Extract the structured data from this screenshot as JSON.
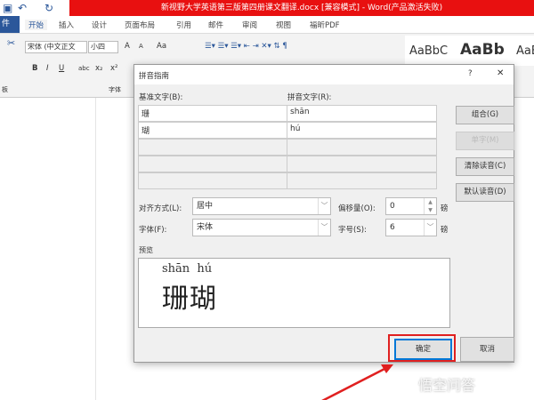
{
  "window": {
    "title": "新视野大学英语第三版第四册课文翻译.docx [兼容模式] - Word(产品激活失败)"
  },
  "qat": {
    "save_icon": "save-icon",
    "undo_icon": "undo-icon",
    "redo_icon": "redo-icon"
  },
  "tabs": {
    "file": "件",
    "items": [
      "开始",
      "插入",
      "设计",
      "页面布局",
      "引用",
      "邮件",
      "审阅",
      "视图",
      "福昕PDF"
    ]
  },
  "ribbon": {
    "font_name": "宋体 (中文正文",
    "font_size": "小四",
    "grow": "A",
    "shrink": "A",
    "case": "Aa",
    "bold": "B",
    "italic": "I",
    "underline": "U",
    "strike": "abc",
    "sub": "x₂",
    "sup": "x²",
    "font_group": "字体",
    "clipboard_group": "板",
    "styles": [
      "AaBbC",
      "AaBb",
      "AaE"
    ]
  },
  "dialog": {
    "title": "拼音指南",
    "help": "?",
    "close": "✕",
    "base_label": "基准文字(B):",
    "ruby_label": "拼音文字(R):",
    "rows": [
      {
        "base": "珊",
        "ruby": "shān"
      },
      {
        "base": "瑚",
        "ruby": "hú"
      },
      {
        "base": "",
        "ruby": ""
      },
      {
        "base": "",
        "ruby": ""
      },
      {
        "base": "",
        "ruby": ""
      }
    ],
    "buttons": {
      "group": "组合(G)",
      "single": "单字(M)",
      "clear": "清除读音(C)",
      "default": "默认读音(D)"
    },
    "align_label": "对齐方式(L):",
    "align_value": "居中",
    "offset_label": "偏移量(O):",
    "offset_value": "0",
    "offset_unit": "磅",
    "font_label": "字体(F):",
    "font_value": "宋体",
    "size_label": "字号(S):",
    "size_value": "6",
    "size_unit": "磅",
    "preview_label": "预览",
    "preview_ruby": "shān  hú",
    "preview_text": "珊瑚",
    "ok": "确定",
    "cancel": "取消"
  },
  "annotation": {
    "highlight_color": "#e02020"
  },
  "watermark": "悟空问答"
}
